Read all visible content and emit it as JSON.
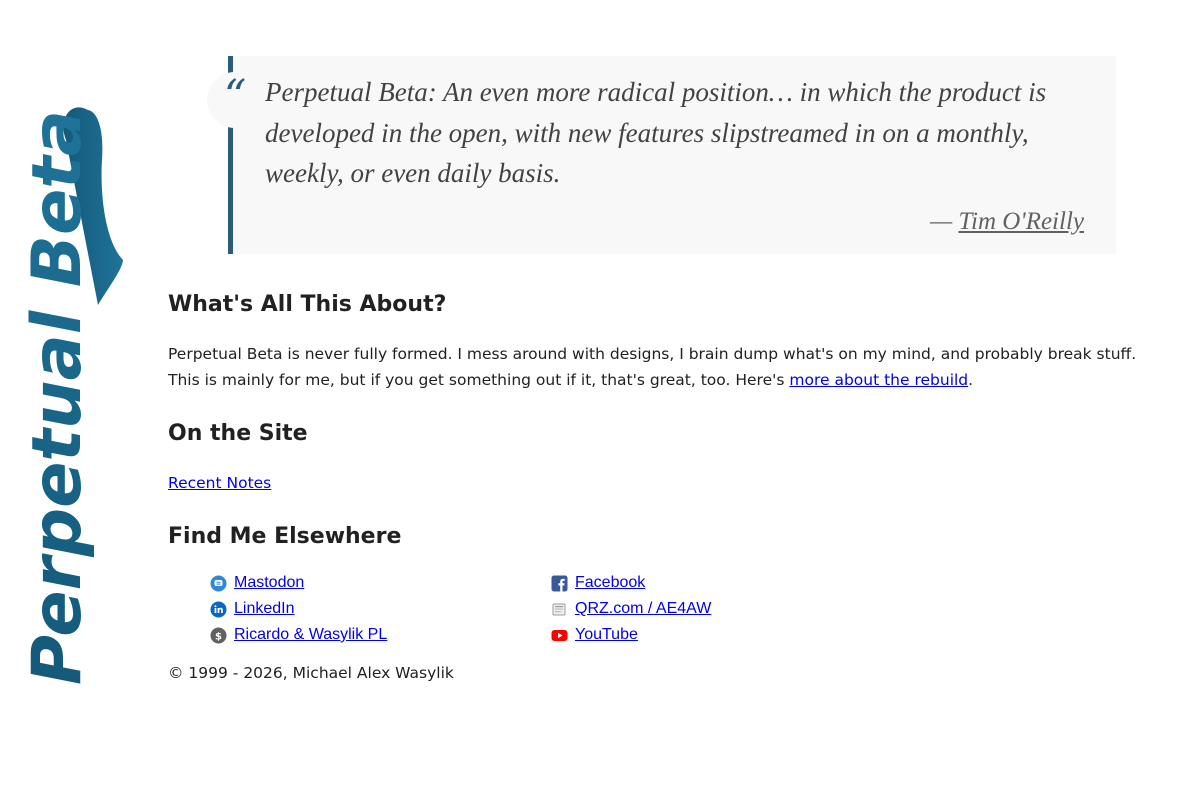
{
  "logo": {
    "text": "Perpetual Beta",
    "color": "#1d6b8e"
  },
  "quote": {
    "mark": "“",
    "text": "Perpetual Beta: An even more radical position… in which the product is developed in the open, with new features slipstreamed in on a monthly, weekly, or even daily basis.",
    "dash": "— ",
    "author": "Tim O'Reilly"
  },
  "about": {
    "heading": "What's All This About?",
    "text": "Perpetual Beta is never fully formed. I mess around with designs, I brain dump what's on my mind, and probably break stuff. This is mainly for me, but if you get something out if it, that's great, too. Here's ",
    "link": "more about the rebuild",
    "end": "."
  },
  "site": {
    "heading": "On the Site",
    "link": "Recent Notes"
  },
  "elsewhere": {
    "heading": "Find Me Elsewhere",
    "links": [
      {
        "label": "Mastodon",
        "icon": "mastodon-icon",
        "color": "#3088d4"
      },
      {
        "label": "Facebook",
        "icon": "facebook-icon",
        "color": "#3b5998"
      },
      {
        "label": "LinkedIn",
        "icon": "linkedin-icon",
        "color": "#0a66c2"
      },
      {
        "label": "QRZ.com / AE4AW",
        "icon": "qrz-icon",
        "color": "#9e9e9e"
      },
      {
        "label": "Ricardo & Wasylik PL",
        "icon": "dollar-icon",
        "color": "#616161"
      },
      {
        "label": "YouTube",
        "icon": "youtube-icon",
        "color": "#ff0000"
      }
    ]
  },
  "footer": {
    "copyright": "© 1999 - 2026, Michael Alex Wasylik"
  },
  "colors": {
    "accent": "#2b5d7a",
    "link": "#0000ee",
    "quote_bg": "#f8f8f8"
  }
}
